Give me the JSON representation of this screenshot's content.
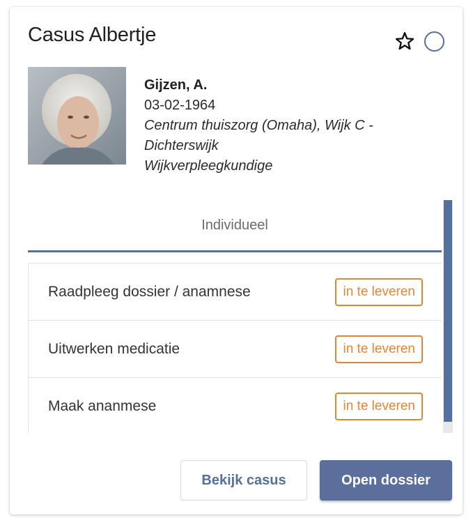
{
  "card": {
    "title": "Casus Albertje",
    "favorite_icon": "star-outline-icon",
    "status_icon": "circle-outline-icon"
  },
  "patient": {
    "name": "Gijzen, A.",
    "birthdate": "03-02-1964",
    "organisation": "Centrum thuiszorg (Omaha), Wijk C - Dichterswijk",
    "role": "Wijkverpleegkundige"
  },
  "tabs": [
    {
      "label": "Individueel",
      "active": true
    }
  ],
  "tasks": [
    {
      "label": "Raadpleeg dossier / anamnese",
      "status": "in te leveren"
    },
    {
      "label": "Uitwerken medicatie",
      "status": "in te leveren"
    },
    {
      "label": "Maak ananmese",
      "status": "in te leveren"
    }
  ],
  "actions": {
    "view_case": "Bekijk casus",
    "open_file": "Open dossier"
  },
  "colors": {
    "accent": "#55709e",
    "badge": "#e28633",
    "primary_button": "#5a6f9b"
  }
}
